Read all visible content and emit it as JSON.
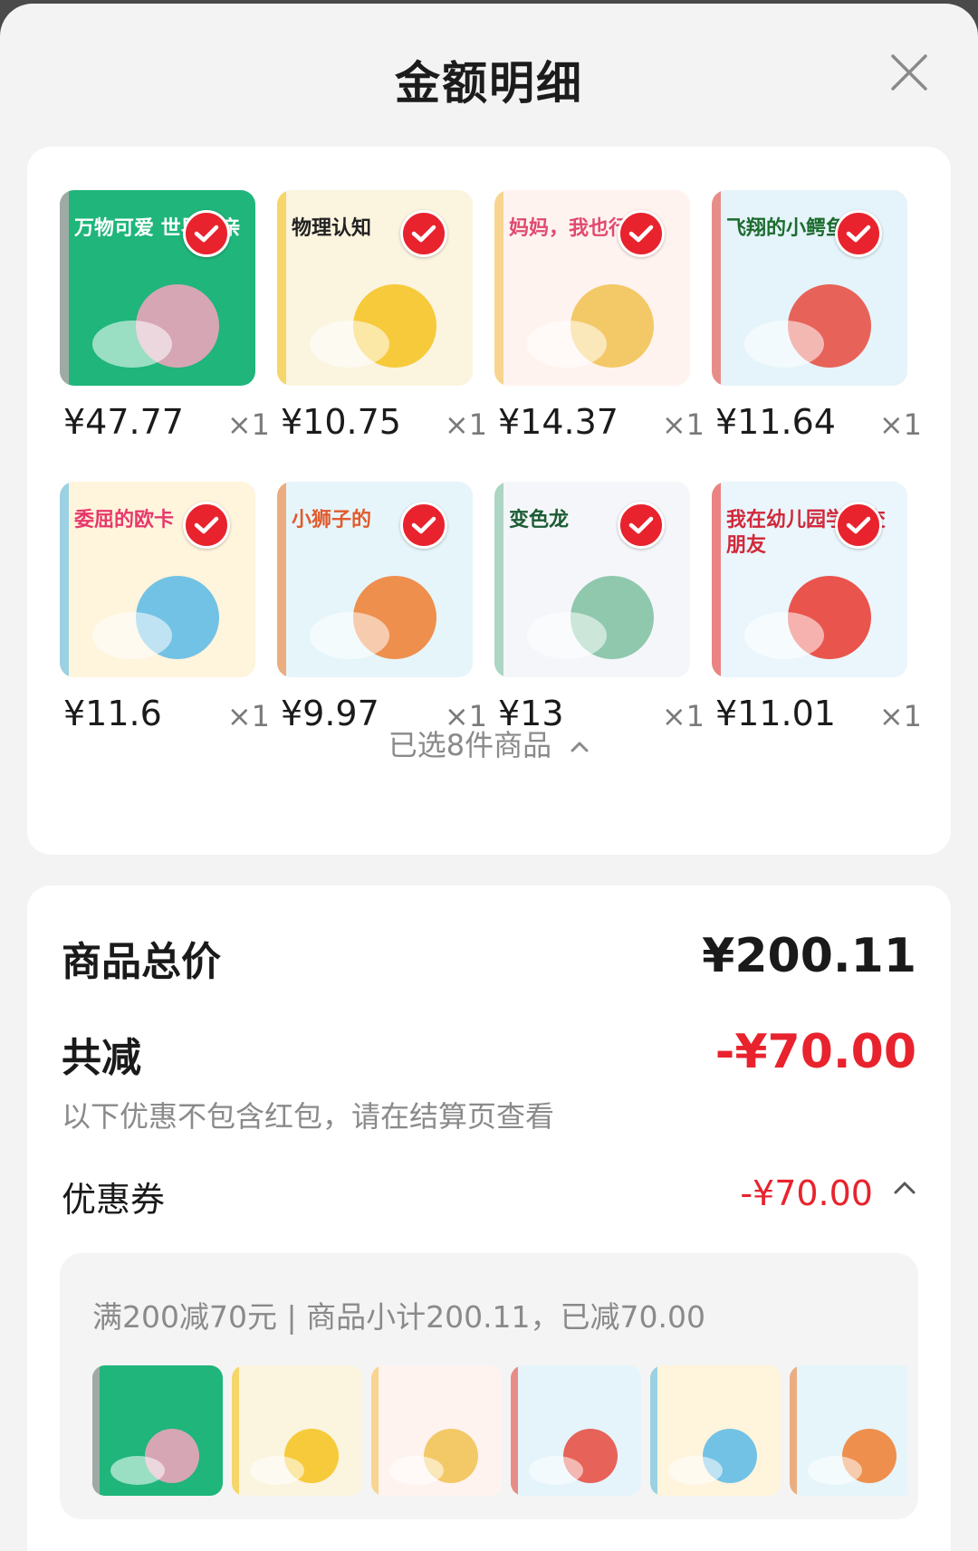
{
  "header": {
    "title": "金额明细"
  },
  "products": [
    {
      "price": "¥47.77",
      "qty": "×1",
      "cover": "万物可爱 世界可亲",
      "bg": "#1fb57b",
      "accent": "#f7a3c0",
      "text_color": "#ffffff"
    },
    {
      "price": "¥10.75",
      "qty": "×1",
      "cover": "物理认知",
      "bg": "#fbf4df",
      "accent": "#f4c21d",
      "text_color": "#222222"
    },
    {
      "price": "¥14.37",
      "qty": "×1",
      "cover": "妈妈，我也行",
      "bg": "#fff3f0",
      "accent": "#f1c14f",
      "text_color": "#e04a6f"
    },
    {
      "price": "¥11.64",
      "qty": "×1",
      "cover": "飞翔的小鳄鱼",
      "bg": "#e5f4fb",
      "accent": "#e7483b",
      "text_color": "#1c6b2e"
    },
    {
      "price": "¥11.6",
      "qty": "×1",
      "cover": "委屈的欧卡",
      "bg": "#fff4dc",
      "accent": "#59b9e6",
      "text_color": "#e7386b"
    },
    {
      "price": "¥9.97",
      "qty": "×1",
      "cover": "小狮子的",
      "bg": "#e6f5fa",
      "accent": "#ef7d2e",
      "text_color": "#e25a2b"
    },
    {
      "price": "¥13",
      "qty": "×1",
      "cover": "变色龙",
      "bg": "#f4f6f9",
      "accent": "#7cc0a0",
      "text_color": "#1b5c34"
    },
    {
      "price": "¥11.01",
      "qty": "×1",
      "cover": "我在幼儿园学会交朋友",
      "bg": "#eaf6fc",
      "accent": "#e9372e",
      "text_color": "#d2283a"
    }
  ],
  "selected_text": "已选8件商品",
  "summary": {
    "total_label": "商品总价",
    "total_value": "¥200.11",
    "discount_label": "共减",
    "discount_value": "-¥70.00",
    "note": "以下优惠不包含红包，请在结算页查看",
    "coupon_label": "优惠券",
    "coupon_value": "-¥70.00",
    "coupon_detail": "满200减70元 | 商品小计200.11，已减70.00"
  },
  "colors": {
    "accent_red": "#e8232d",
    "sheet_bg": "#f3f3f3"
  },
  "icons": {
    "close": "close-icon",
    "check": "check-icon",
    "chevron": "chevron-up-icon"
  }
}
